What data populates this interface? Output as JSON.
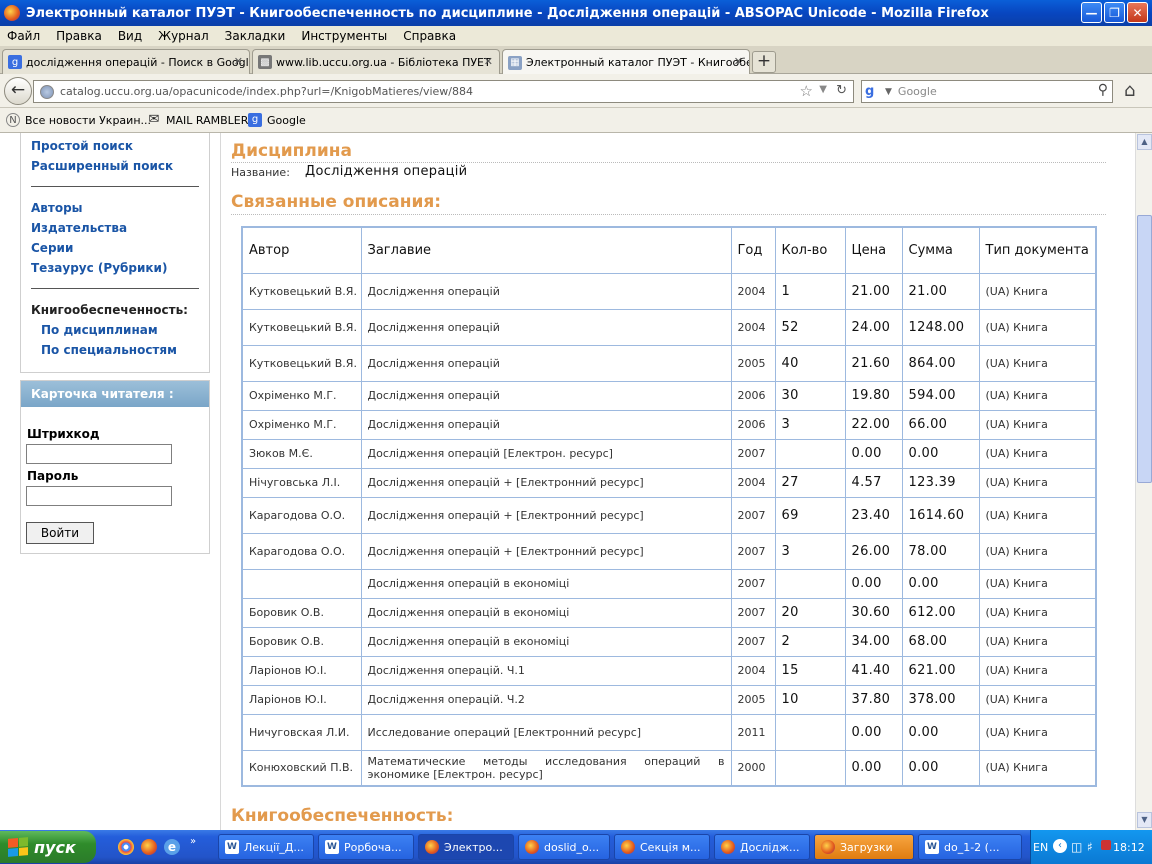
{
  "window": {
    "title": "Электронный каталог ПУЭТ - Книгообеспеченность по дисциплине - Дослідження операцій - ABSOPAC Unicode - Mozilla Firefox"
  },
  "menu": [
    "Файл",
    "Правка",
    "Вид",
    "Журнал",
    "Закладки",
    "Инструменты",
    "Справка"
  ],
  "tabs": [
    {
      "label": "дослідження операцій - Поиск в Google"
    },
    {
      "label": "www.lib.uccu.org.ua - Бібліотека ПУЕТ"
    },
    {
      "label": "Электронный каталог ПУЭТ - Книгообе..."
    }
  ],
  "nav": {
    "url": "catalog.uccu.org.ua/opacunicode/index.php?url=/KnigobMatieres/view/884",
    "search_placeholder": "Google"
  },
  "bookmarks": [
    "Все новости Украин...",
    "MAIL RAMBLER",
    "Google"
  ],
  "sidebar": {
    "links_top": [
      "Простой поиск",
      "Расширенный поиск"
    ],
    "links_mid": [
      "Авторы",
      "Издательства",
      "Серии",
      "Тезаурус (Рубрики)"
    ],
    "provision_title": "Книгообеспеченность:",
    "provision_links": [
      "По дисциплинам",
      "По специальностям"
    ]
  },
  "card": {
    "title": "Карточка читателя :",
    "barcode_label": "Штрихкод",
    "password_label": "Пароль",
    "login_button": "Войти"
  },
  "main": {
    "discipline_heading": "Дисциплина",
    "name_label": "Название:",
    "name_value": "Дослідження операцій",
    "related_heading": "Связанные описания:",
    "provision_heading": "Книгообеспеченность:"
  },
  "table": {
    "headers": [
      "Автор",
      "Заглавие",
      "Год",
      "Кол-во",
      "Цена",
      "Сумма",
      "Тип документа"
    ],
    "rows": [
      [
        "Кутковецький В.Я.",
        "Дослідження операцій",
        "2004",
        "1",
        "21.00",
        "21.00",
        "(UA) Книга"
      ],
      [
        "Кутковецький В.Я.",
        "Дослідження операцій",
        "2004",
        "52",
        "24.00",
        "1248.00",
        "(UA) Книга"
      ],
      [
        "Кутковецький В.Я.",
        "Дослідження операцій",
        "2005",
        "40",
        "21.60",
        "864.00",
        "(UA) Книга"
      ],
      [
        "Охріменко М.Г.",
        "Дослідження операцій",
        "2006",
        "30",
        "19.80",
        "594.00",
        "(UA) Книга"
      ],
      [
        "Охріменко М.Г.",
        "Дослідження операцій",
        "2006",
        "3",
        "22.00",
        "66.00",
        "(UA) Книга"
      ],
      [
        "Зюков М.Є.",
        "Дослідження операцій [Електрон. ресурс]",
        "2007",
        "",
        "0.00",
        "0.00",
        "(UA) Книга"
      ],
      [
        "Нічуговська Л.І.",
        "Дослідження операцій + [Електронний ресурс]",
        "2004",
        "27",
        "4.57",
        "123.39",
        "(UA) Книга"
      ],
      [
        "Карагодова О.О.",
        "Дослідження операцій + [Електронний ресурс]",
        "2007",
        "69",
        "23.40",
        "1614.60",
        "(UA) Книга"
      ],
      [
        "Карагодова О.О.",
        "Дослідження операцій + [Електронний ресурс]",
        "2007",
        "3",
        "26.00",
        "78.00",
        "(UA) Книга"
      ],
      [
        "",
        "Дослідження операцій в економіці",
        "2007",
        "",
        "0.00",
        "0.00",
        "(UA) Книга"
      ],
      [
        "Боровик О.В.",
        "Дослідження операцій в економіці",
        "2007",
        "20",
        "30.60",
        "612.00",
        "(UA) Книга"
      ],
      [
        "Боровик О.В.",
        "Дослідження операцій в економіці",
        "2007",
        "2",
        "34.00",
        "68.00",
        "(UA) Книга"
      ],
      [
        "Ларіонов Ю.І.",
        "Дослідження операцій. Ч.1",
        "2004",
        "15",
        "41.40",
        "621.00",
        "(UA) Книга"
      ],
      [
        "Ларіонов Ю.І.",
        "Дослідження операцій. Ч.2",
        "2005",
        "10",
        "37.80",
        "378.00",
        "(UA) Книга"
      ],
      [
        "Ничуговская Л.И.",
        "Исследование операций [Електронний ресурс]",
        "2011",
        "",
        "0.00",
        "0.00",
        "(UA) Книга"
      ],
      [
        "Конюховский П.В.",
        "Математические методы исследования операций в экономике [Електрон. ресурс]",
        "2000",
        "",
        "0.00",
        "0.00",
        "(UA) Книга"
      ]
    ]
  },
  "taskbar": {
    "start": "пуск",
    "items": [
      "Лекції_Д...",
      "Рорбоча...",
      "Электро...",
      "doslid_o...",
      "Секція м...",
      "Дослідж...",
      "Загрузки",
      "do_1-2 (..."
    ],
    "lang": "EN",
    "clock": "18:12"
  }
}
